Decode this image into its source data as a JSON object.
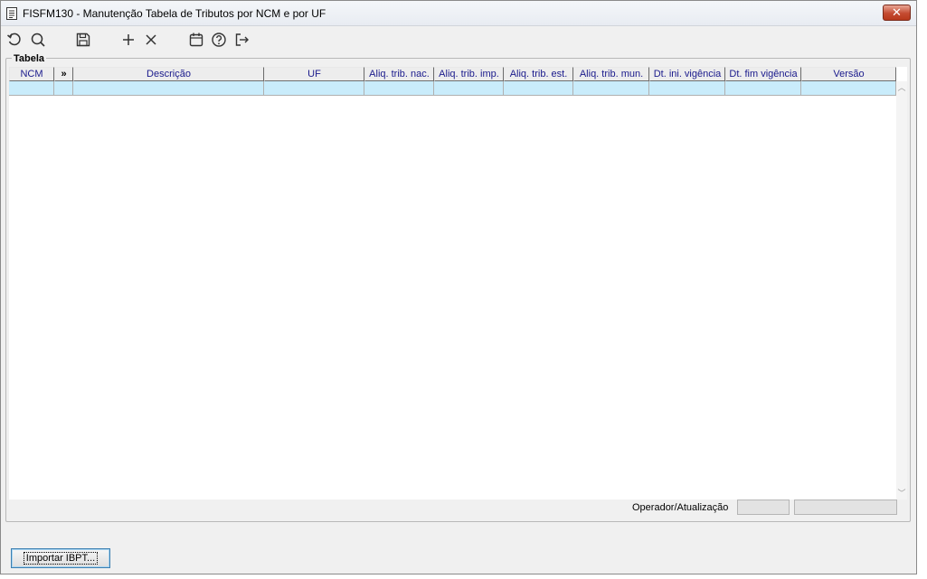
{
  "window": {
    "title": "FISFM130 - Manutenção Tabela de Tributos por NCM e por UF",
    "close_label": "✕"
  },
  "toolbar": {
    "items": [
      {
        "icon": "undo-icon"
      },
      {
        "icon": "search-icon"
      },
      {
        "icon": "save-icon"
      },
      {
        "icon": "add-icon"
      },
      {
        "icon": "delete-icon"
      },
      {
        "icon": "calendar-icon"
      },
      {
        "icon": "help-icon"
      },
      {
        "icon": "exit-icon"
      }
    ]
  },
  "group": {
    "label": "Tabela"
  },
  "grid": {
    "columns": [
      {
        "label": "NCM"
      },
      {
        "label": "»"
      },
      {
        "label": "Descrição"
      },
      {
        "label": "UF"
      },
      {
        "label": "Aliq. trib. nac."
      },
      {
        "label": "Aliq. trib. imp."
      },
      {
        "label": "Aliq. trib. est."
      },
      {
        "label": "Aliq. trib. mun."
      },
      {
        "label": "Dt. ini. vigência"
      },
      {
        "label": "Dt. fim vigência"
      },
      {
        "label": "Versão"
      }
    ],
    "selected_row_color": "#c9ecfb"
  },
  "footer": {
    "operator_label": "Operador/Atualização",
    "operator_value": "",
    "update_value": ""
  },
  "actions": {
    "import_label": "Importar IBPT..."
  },
  "colors": {
    "header_text": "#1a1a8c",
    "window_bg": "#f0f0f0",
    "close_button": "#c44b31"
  }
}
